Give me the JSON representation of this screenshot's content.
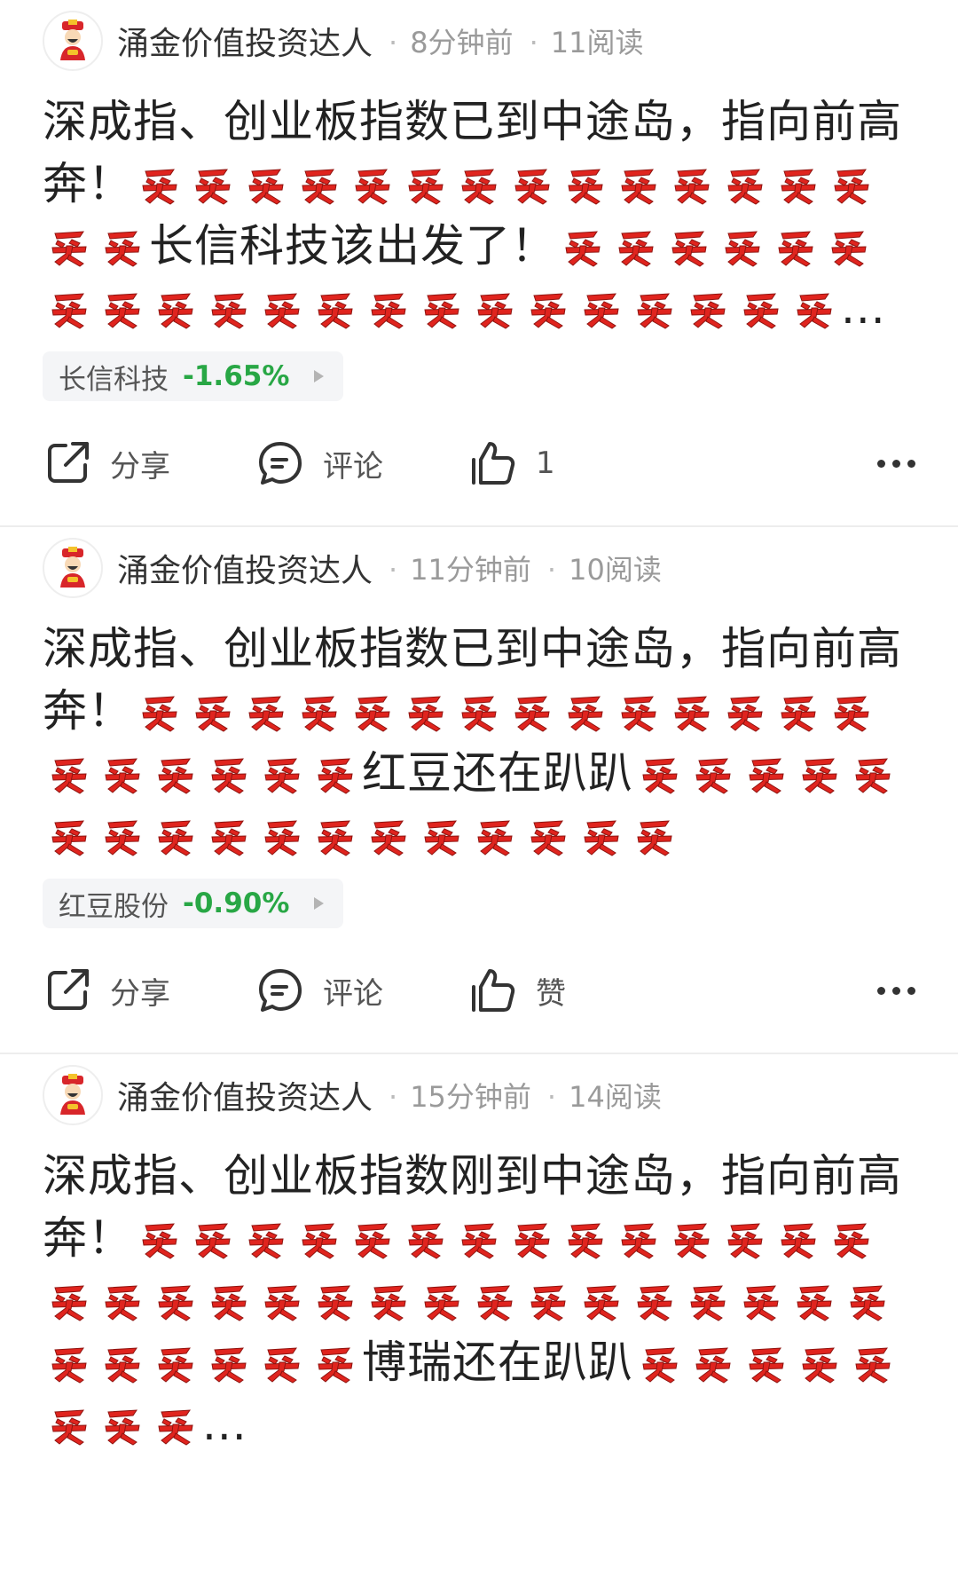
{
  "posts": [
    {
      "author": "涌金价值投资达人",
      "time": "8分钟前",
      "reads": "11阅读",
      "seg1": "深成指、创业板指数已到中途岛，指向前高奔！",
      "emo1": 14,
      "seg2_pre": 2,
      "seg2": "长信科技该出发了！",
      "emo2": 21,
      "ellipsis": "...",
      "stock_name": "长信科技",
      "stock_pct": "-1.65%",
      "share": "分享",
      "comment": "评论",
      "like": "1"
    },
    {
      "author": "涌金价值投资达人",
      "time": "11分钟前",
      "reads": "10阅读",
      "seg1": "深成指、创业板指数已到中途岛，指向前高奔！",
      "emo1": 14,
      "seg2_pre": 6,
      "seg2": "红豆还在趴趴",
      "emo2": 17,
      "ellipsis": "",
      "stock_name": "红豆股份",
      "stock_pct": "-0.90%",
      "share": "分享",
      "comment": "评论",
      "like": "赞"
    },
    {
      "author": "涌金价值投资达人",
      "time": "15分钟前",
      "reads": "14阅读",
      "seg1": "深成指、创业板指数刚到中途岛，指向前高奔！",
      "emo1": 14,
      "seg2_pre": 22,
      "seg2": "博瑞还在趴趴",
      "emo2": 8,
      "ellipsis": "...",
      "stock_name": "",
      "stock_pct": "",
      "share": "",
      "comment": "",
      "like": ""
    }
  ],
  "icons": {
    "emoji": "buy-emoji-icon",
    "avatar": "fortune-god-avatar"
  },
  "colors": {
    "positive_tag": "#28a745",
    "emoji_red": "#e0241e"
  }
}
